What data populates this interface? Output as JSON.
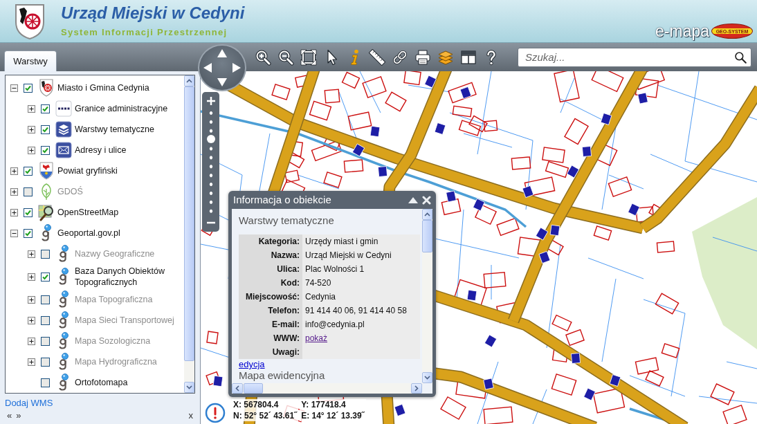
{
  "header": {
    "title": "Urząd Miejski w Cedyni",
    "subtitle": "System Informacji Przestrzennej",
    "brand": "e-mapa",
    "brand_logo": "GEO-SYSTEM"
  },
  "tabs": [
    {
      "label": "Warstwy",
      "selected": true
    }
  ],
  "search": {
    "placeholder": "Szukaj..."
  },
  "layers": [
    {
      "label": "Miasto i Gmina Cedynia",
      "kind": "municipality",
      "expanded": true,
      "checked": true,
      "dimmed": false,
      "children": [
        {
          "label": "Granice administracyjne",
          "kind": "boundaries",
          "expanded": false,
          "checked": true,
          "dimmed": false
        },
        {
          "label": "Warstwy tematyczne",
          "kind": "thematic",
          "expanded": false,
          "checked": true,
          "dimmed": false
        },
        {
          "label": "Adresy i ulice",
          "kind": "addresses",
          "expanded": false,
          "checked": true,
          "dimmed": false
        }
      ]
    },
    {
      "label": "Powiat gryfiński",
      "kind": "county",
      "expanded": false,
      "checked": true,
      "dimmed": false
    },
    {
      "label": "GDOŚ",
      "kind": "nature",
      "expanded": false,
      "checked": false,
      "dimmed": true
    },
    {
      "label": "OpenStreetMap",
      "kind": "osm",
      "expanded": false,
      "checked": true,
      "dimmed": false
    },
    {
      "label": "Geoportal.gov.pl",
      "kind": "geoportal",
      "expanded": true,
      "checked": true,
      "dimmed": false,
      "children": [
        {
          "label": "Nazwy Geograficzne",
          "kind": "geoportal",
          "expanded": false,
          "checked": false,
          "dimmed": true
        },
        {
          "label": "Baza Danych Obiektów Topograficznych",
          "kind": "geoportal",
          "expanded": false,
          "checked": true,
          "dimmed": false
        },
        {
          "label": "Mapa Topograficzna",
          "kind": "geoportal",
          "expanded": false,
          "checked": false,
          "dimmed": true
        },
        {
          "label": "Mapa Sieci Transportowej",
          "kind": "geoportal",
          "expanded": false,
          "checked": false,
          "dimmed": true
        },
        {
          "label": "Mapa Sozologiczna",
          "kind": "geoportal",
          "expanded": false,
          "checked": false,
          "dimmed": true
        },
        {
          "label": "Mapa Hydrograficzna",
          "kind": "geoportal",
          "expanded": false,
          "checked": false,
          "dimmed": true
        },
        {
          "label": "Ortofotomapa",
          "kind": "geoportal",
          "checked": false,
          "dimmed": false
        }
      ]
    }
  ],
  "layer_panel": {
    "add_link": "Dodaj WMS",
    "prev": "«",
    "next": "»",
    "close": "x"
  },
  "zoom_slider": {
    "level": 0.73
  },
  "info_popup": {
    "title": "Informacja o obiekcie",
    "section": "Warstwy tematyczne",
    "fields": [
      {
        "label": "Kategoria:",
        "value": "Urzędy miast i gmin",
        "kind": "text"
      },
      {
        "label": "Nazwa:",
        "value": "Urząd Miejski w Cedyni",
        "kind": "text"
      },
      {
        "label": "Ulica:",
        "value": "Plac Wolności 1",
        "kind": "text"
      },
      {
        "label": "Kod:",
        "value": "74-520",
        "kind": "text"
      },
      {
        "label": "Miejscowość:",
        "value": "Cedynia",
        "kind": "text"
      },
      {
        "label": "Telefon:",
        "value": "91 414 40 06, 91 414 40 58",
        "kind": "text"
      },
      {
        "label": "E-mail:",
        "value": "info@cedynia.pl",
        "kind": "text"
      },
      {
        "label": "WWW:",
        "value": "pokaż",
        "kind": "link"
      },
      {
        "label": "Uwagi:",
        "kind": "text"
      }
    ],
    "edit_link": "edycja",
    "next_section": "Mapa ewidencyjna"
  },
  "coordinates": {
    "x": "X: 567804.4",
    "y": "Y: 177418.4",
    "n": "N: 52° 52´ 43.61˝",
    "e": "E: 14° 12´ 13.39˝"
  }
}
